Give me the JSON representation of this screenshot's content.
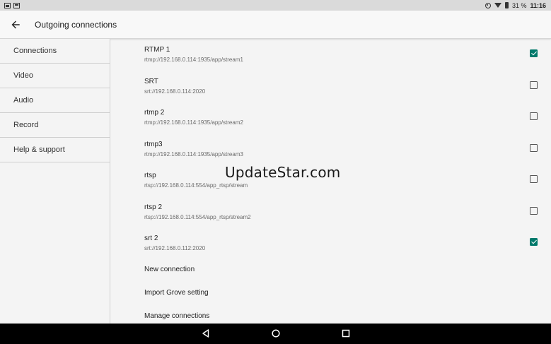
{
  "status_bar": {
    "battery": "31 %",
    "time": "11:16"
  },
  "app_bar": {
    "title": "Outgoing connections"
  },
  "sidebar": {
    "items": [
      {
        "label": "Connections"
      },
      {
        "label": "Video"
      },
      {
        "label": "Audio"
      },
      {
        "label": "Record"
      },
      {
        "label": "Help & support"
      }
    ]
  },
  "connections": [
    {
      "name": "RTMP 1",
      "url": "rtmp://192.168.0.114:1935/app/stream1",
      "checked": true
    },
    {
      "name": "SRT",
      "url": "srt://192.168.0.114:2020",
      "checked": false
    },
    {
      "name": "rtmp 2",
      "url": "rtmp://192.168.0.114:1935/app/stream2",
      "checked": false
    },
    {
      "name": "rtmp3",
      "url": "rtmp://192.168.0.114:1935/app/stream3",
      "checked": false
    },
    {
      "name": "rtsp",
      "url": "rtsp://192.168.0.114:554/app_rtsp/stream",
      "checked": false
    },
    {
      "name": "rtsp 2",
      "url": "rtsp://192.168.0.114:554/app_rtsp/stream2",
      "checked": false
    },
    {
      "name": "srt 2",
      "url": "srt://192.168.0.112:2020",
      "checked": true
    }
  ],
  "actions": {
    "new_connection": "New connection",
    "import_grove": "Import Grove setting",
    "manage_connections": "Manage connections"
  },
  "watermark": "UpdateStar.com",
  "colors": {
    "accent": "#00796b",
    "nav_bar": "#000000",
    "status_bar": "#dadada"
  }
}
